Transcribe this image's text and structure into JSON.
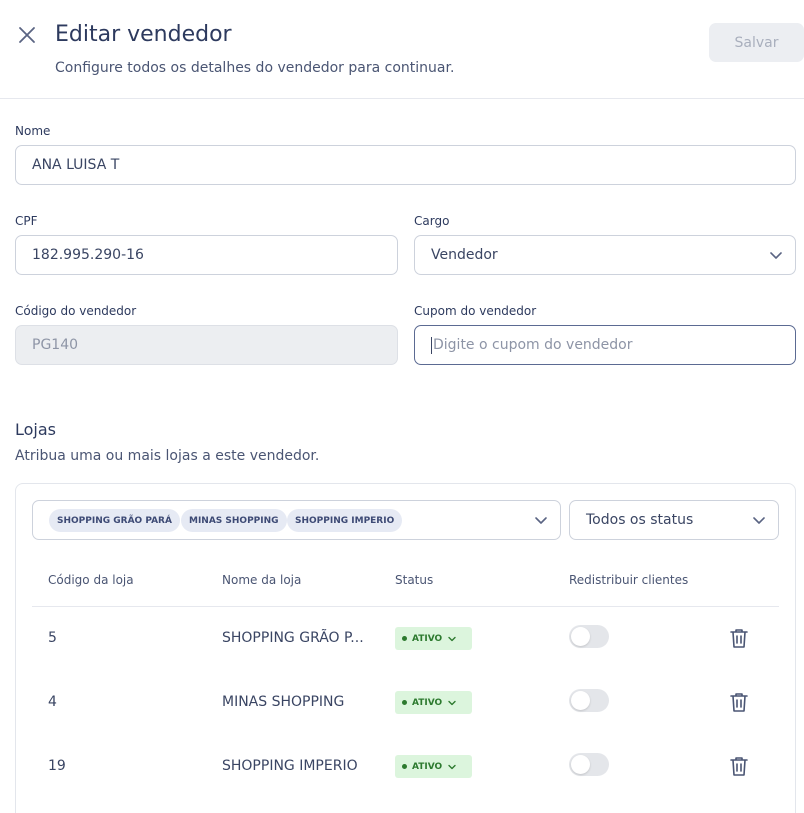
{
  "header": {
    "title": "Editar vendedor",
    "subtitle": "Configure todos os detalhes do vendedor para continuar.",
    "save_label": "Salvar",
    "close_icon": "close-icon"
  },
  "form": {
    "name": {
      "label": "Nome",
      "value": "ANA LUISA T"
    },
    "cpf": {
      "label": "CPF",
      "value": "182.995.290-16"
    },
    "role": {
      "label": "Cargo",
      "value": "Vendedor"
    },
    "seller_code": {
      "label": "Código do vendedor",
      "value": "PG140"
    },
    "coupon": {
      "label": "Cupom do vendedor",
      "placeholder": "Digite o cupom do vendedor"
    }
  },
  "stores": {
    "title": "Lojas",
    "subtitle": "Atribua uma ou mais lojas a este vendedor.",
    "selected_chips": [
      "SHOPPING GRÃO PARÁ",
      "MINAS SHOPPING",
      "SHOPPING IMPERIO"
    ],
    "status_filter": "Todos os status",
    "columns": [
      "Código da loja",
      "Nome da loja",
      "Status",
      "Redistribuir clientes"
    ],
    "rows": [
      {
        "code": "5",
        "name": "SHOPPING GRÃO P...",
        "status": "ATIVO",
        "redistribute": false
      },
      {
        "code": "4",
        "name": "MINAS SHOPPING",
        "status": "ATIVO",
        "redistribute": false
      },
      {
        "code": "19",
        "name": "SHOPPING IMPERIO",
        "status": "ATIVO",
        "redistribute": false
      }
    ]
  },
  "colors": {
    "primary_text": "#2d3a5e",
    "badge_bg": "#dcf5dd",
    "badge_text": "#2d7a2f",
    "chip_bg": "#e6eaf4",
    "disabled_button": "#eceef2"
  }
}
